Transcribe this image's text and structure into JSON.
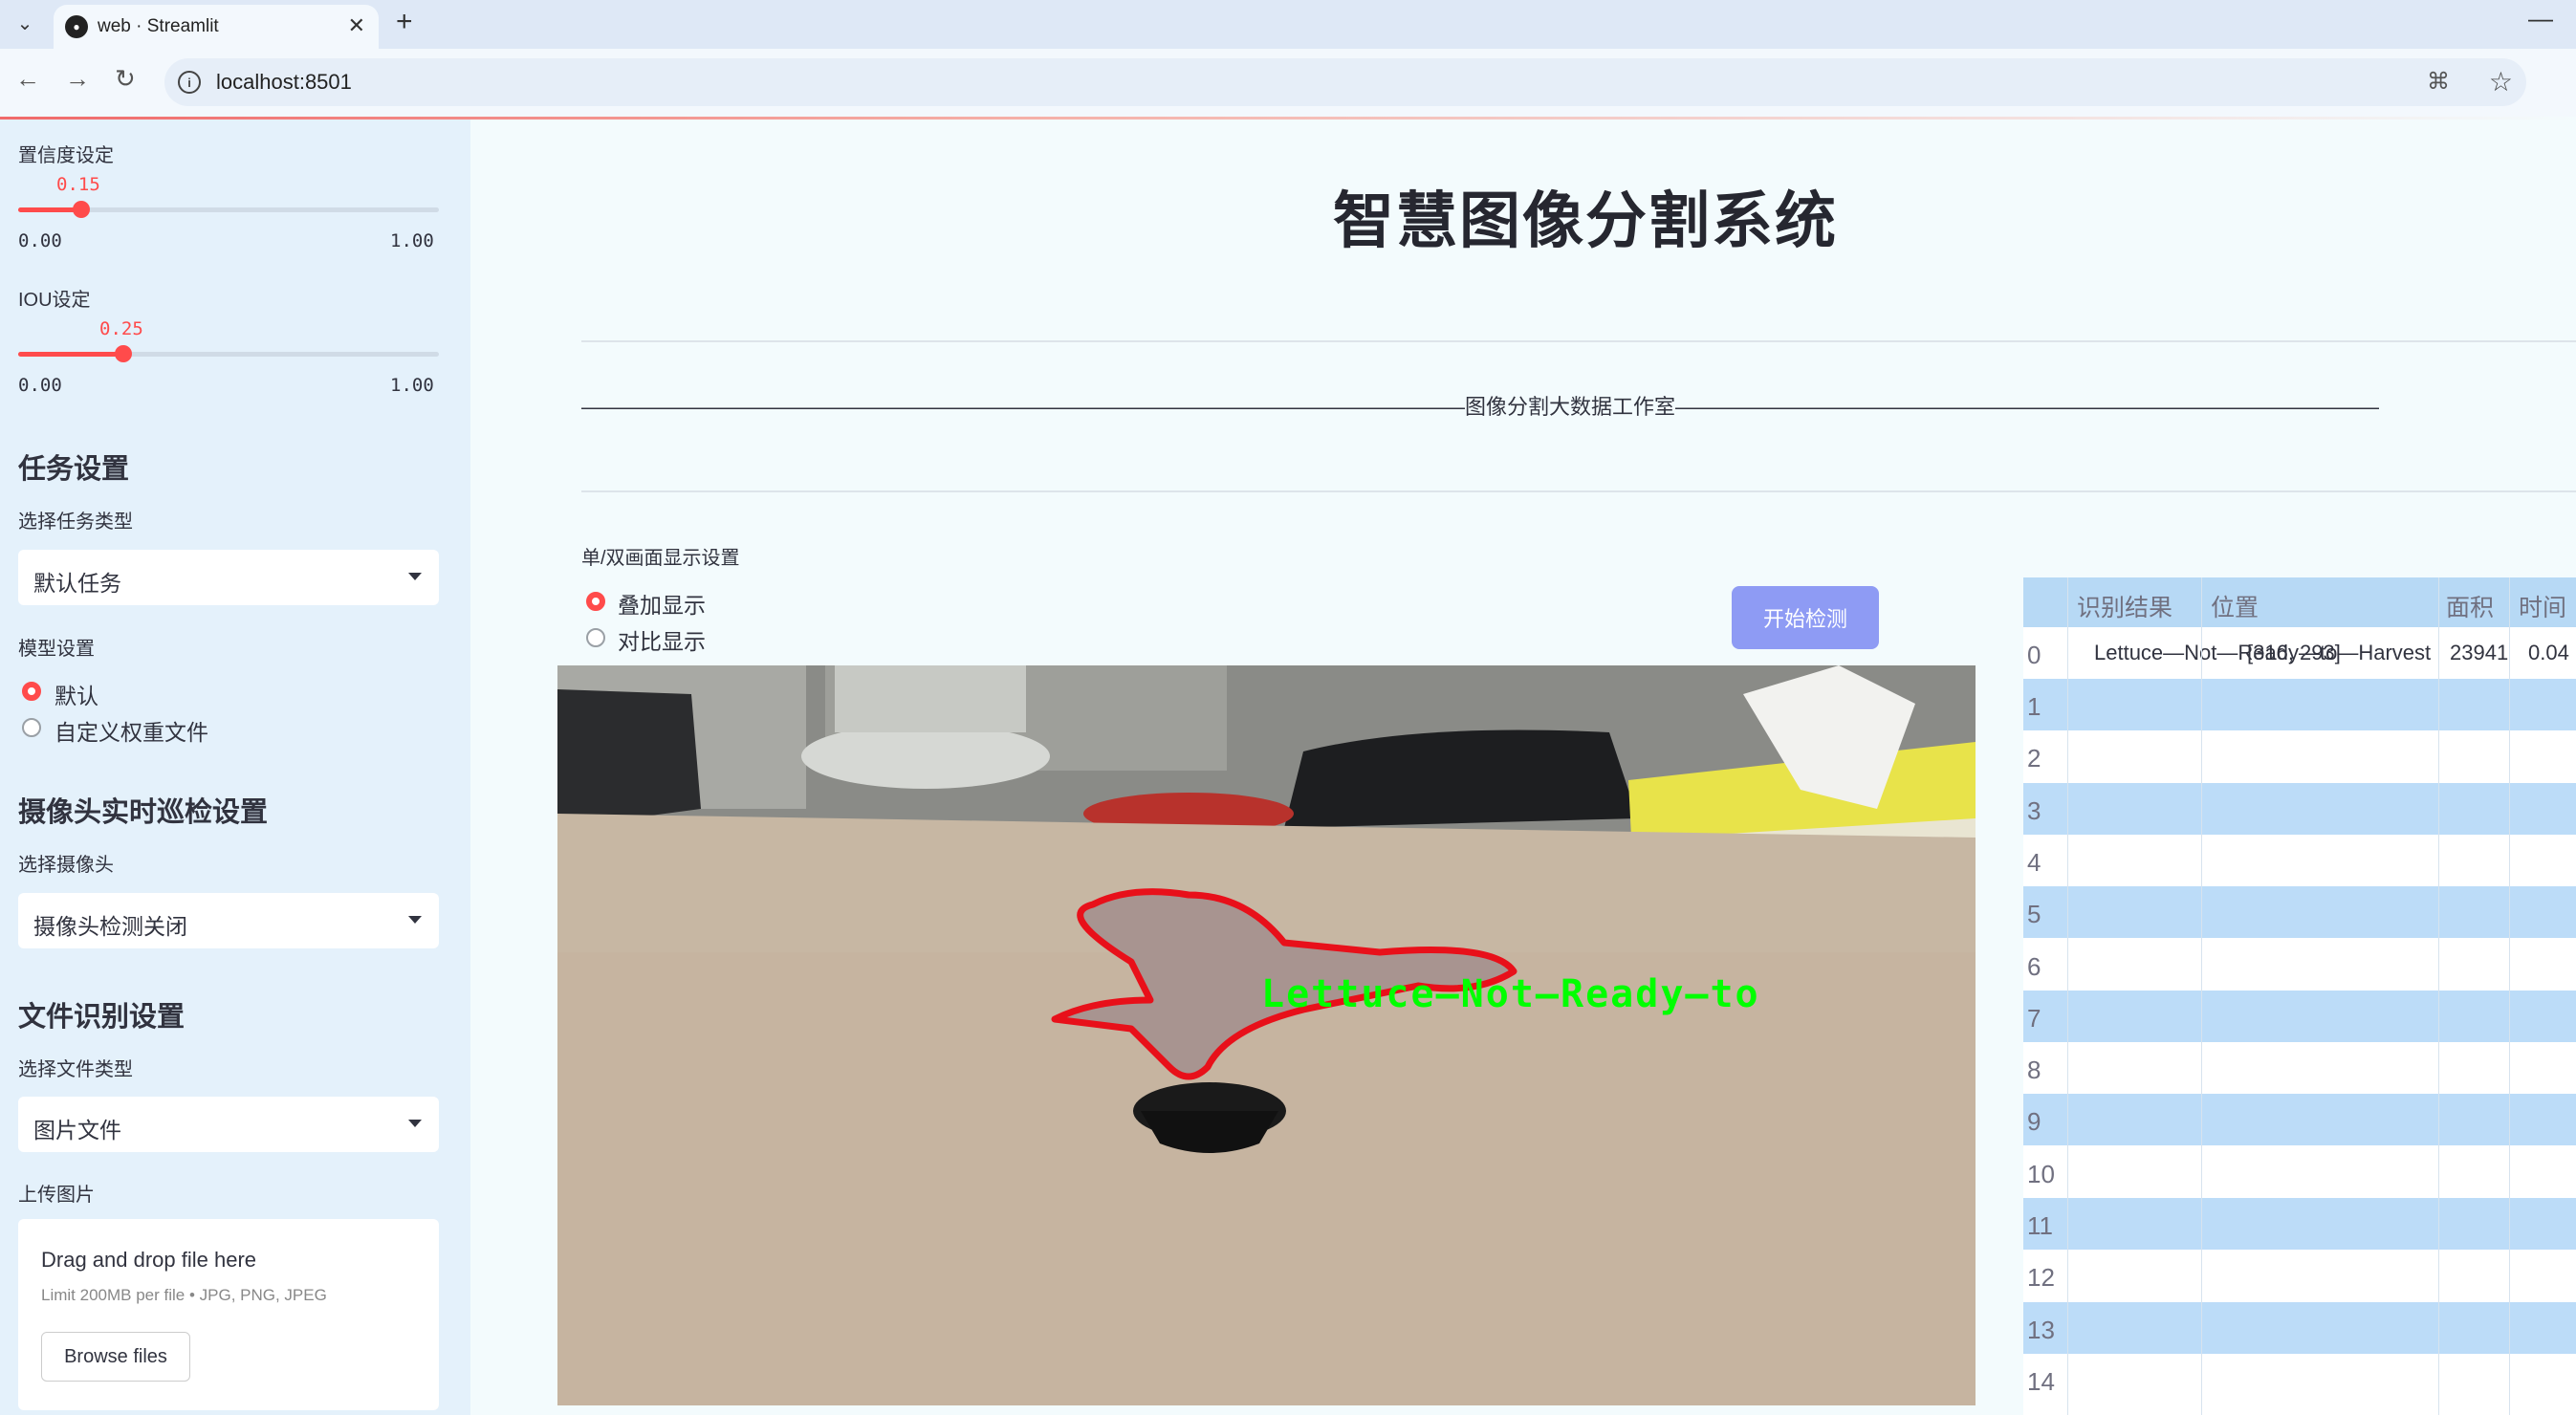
{
  "browser": {
    "tab_title": "web · Streamlit",
    "url": "localhost:8501"
  },
  "sidebar": {
    "confidence": {
      "label": "置信度设定",
      "value": "0.15",
      "min": "0.00",
      "max": "1.00",
      "fraction": 0.15
    },
    "iou": {
      "label": "IOU设定",
      "value": "0.25",
      "min": "0.00",
      "max": "1.00",
      "fraction": 0.25
    },
    "task_section": "任务设置",
    "task_type_label": "选择任务类型",
    "task_type_value": "默认任务",
    "model_label": "模型设置",
    "model_options": [
      "默认",
      "自定义权重文件"
    ],
    "camera_section": "摄像头实时巡检设置",
    "camera_label": "选择摄像头",
    "camera_value": "摄像头检测关闭",
    "file_section": "文件识别设置",
    "file_type_label": "选择文件类型",
    "file_type_value": "图片文件",
    "upload_label": "上传图片",
    "upload_main": "Drag and drop file here",
    "upload_sub": "Limit 200MB per file • JPG, PNG, JPEG",
    "browse_label": "Browse files"
  },
  "main": {
    "title": "智慧图像分割系统",
    "divider_text": "——————————————————————————————————————————图像分割大数据工作室—————————————————————————————————————————",
    "display_mode_label": "单/双画面显示设置",
    "display_options": [
      "叠加显示",
      "对比显示"
    ],
    "detect_button": "开始检测",
    "detection_label": "Lettuce—Not—Ready—to"
  },
  "table": {
    "headers": [
      "识别结果",
      "位置",
      "面积",
      "时间"
    ],
    "row0": {
      "index": "0",
      "result": "Lettuce—Not—Ready—to—Harvest",
      "position": "[316, 293]",
      "area": "23941",
      "time": "0.04"
    },
    "empty_indices": [
      "1",
      "2",
      "3",
      "4",
      "5",
      "6",
      "7",
      "8",
      "9",
      "10",
      "11",
      "12",
      "13",
      "14"
    ]
  }
}
